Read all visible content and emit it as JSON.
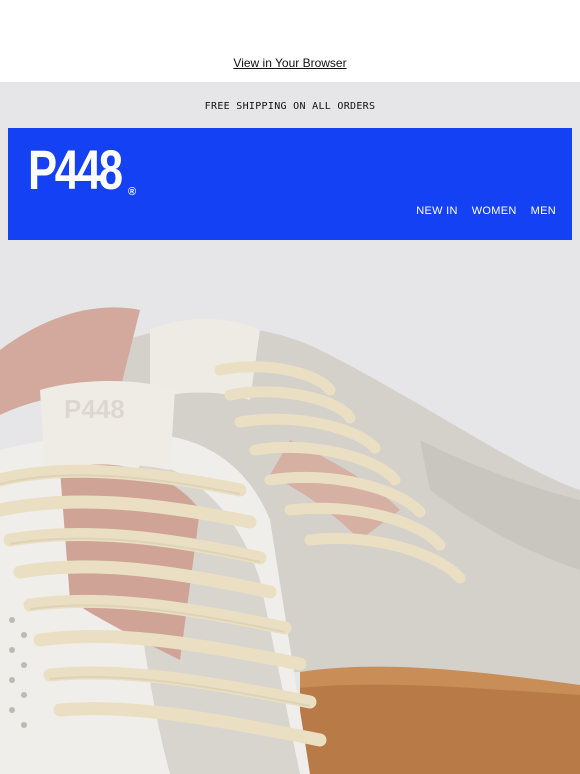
{
  "preheader": {
    "view_in_browser": "View in Your Browser"
  },
  "banner": {
    "shipping_text": "FREE SHIPPING ON ALL ORDERS"
  },
  "header": {
    "brand": "P448",
    "brand_mark": "®",
    "nav": [
      "NEW IN",
      "WOMEN",
      "MEN"
    ]
  },
  "hero": {
    "tongue_label": "P448"
  },
  "colors": {
    "header_blue": "#1541f5",
    "page_gray": "#e6e5e8",
    "lace_cream": "#eadfc3",
    "suede_gray": "#d4d1cb",
    "sole_gum": "#b87a47",
    "lining_pink": "#d3a99d"
  }
}
